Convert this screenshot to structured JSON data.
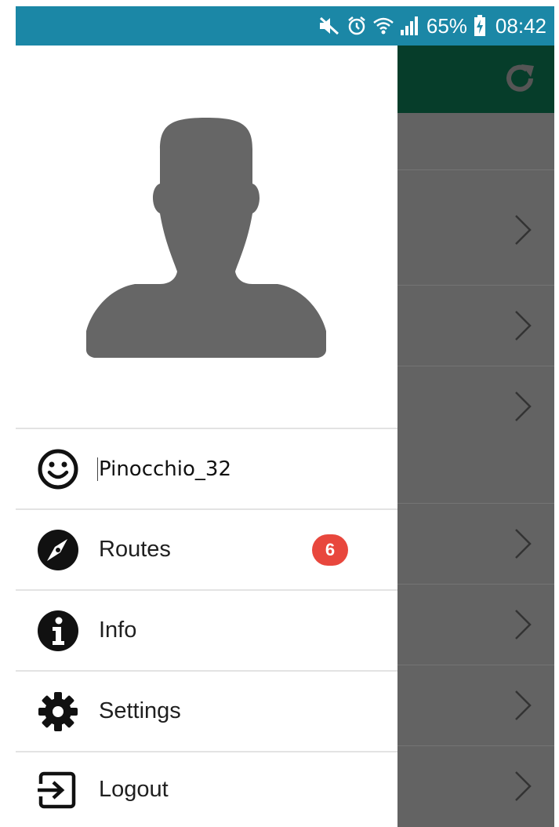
{
  "status_bar": {
    "battery": "65%",
    "time": "08:42",
    "icons": [
      "mute-icon",
      "alarm-icon",
      "wifi-icon",
      "signal-icon",
      "battery-charging-icon"
    ]
  },
  "drawer": {
    "avatar": "person-silhouette-icon",
    "items": [
      {
        "label": "Pinocchio_32",
        "icon": "smiley-icon"
      },
      {
        "label": "Routes",
        "icon": "compass-icon",
        "badge": "6"
      },
      {
        "label": "Info",
        "icon": "info-icon"
      },
      {
        "label": "Settings",
        "icon": "gear-icon"
      },
      {
        "label": "Logout",
        "icon": "logout-icon"
      }
    ]
  },
  "background": {
    "toolbar_icon": "refresh-icon",
    "row_icon": "chevron-right-icon"
  },
  "colors": {
    "status_bar": "#1b87a6",
    "toolbar": "#063d2a",
    "scrim": "#636363",
    "badge": "#e8473d",
    "icon_gray": "#666666"
  }
}
